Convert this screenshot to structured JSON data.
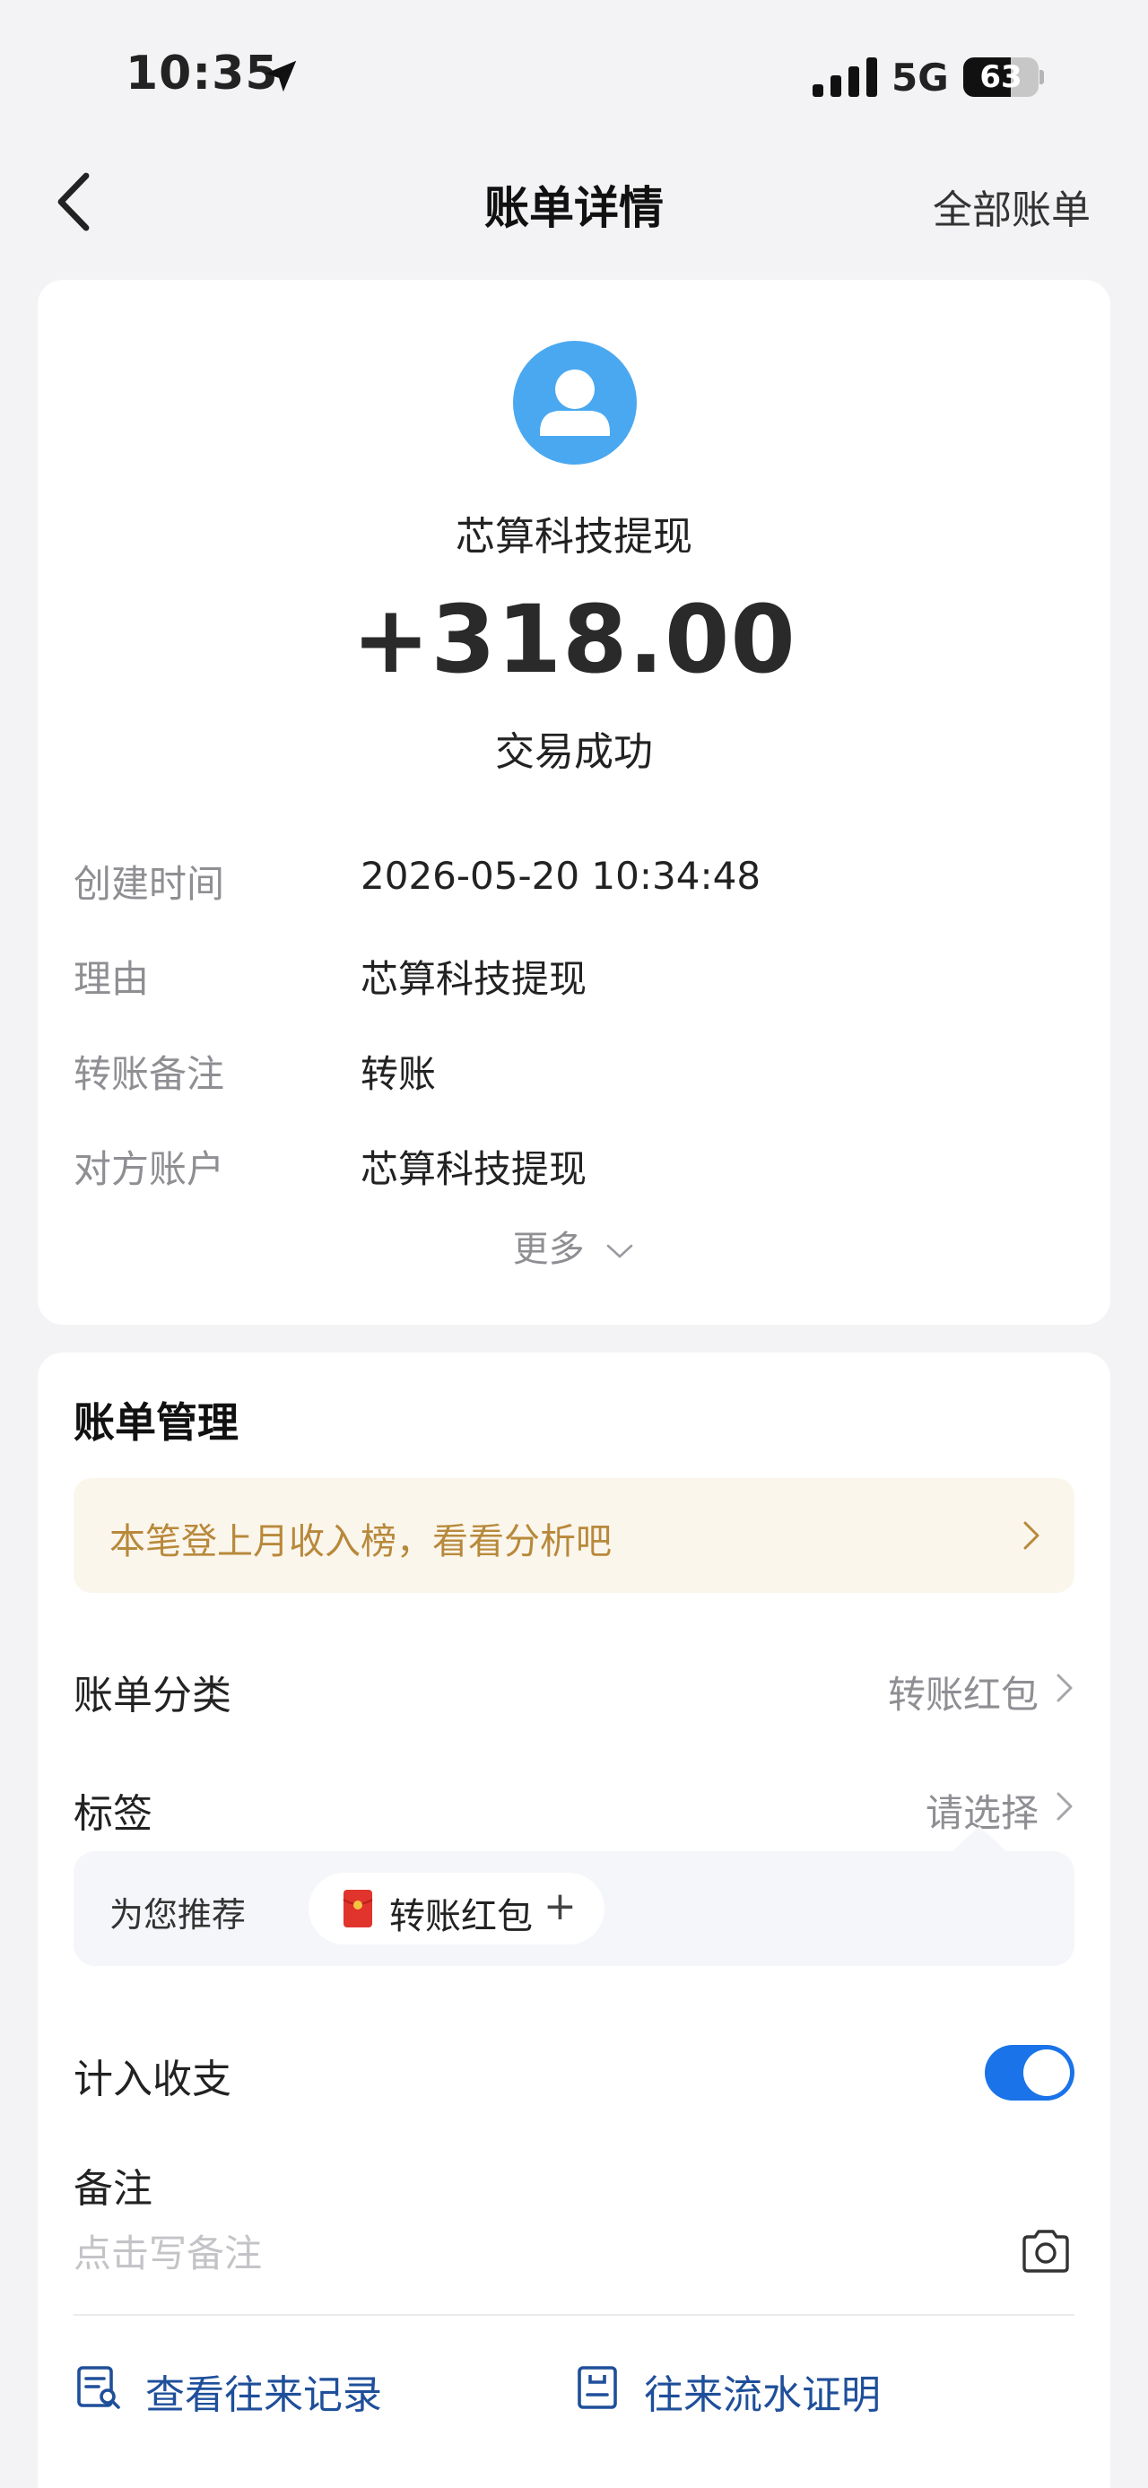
{
  "status_bar": {
    "time": "10:35",
    "network": "5G",
    "battery": "63",
    "battery_level_percent": 63
  },
  "header": {
    "title": "账单详情",
    "right_link": "全部账单"
  },
  "summary": {
    "payee": "芯算科技提现",
    "amount": "+318.00",
    "status": "交易成功"
  },
  "details": [
    {
      "label": "创建时间",
      "value": "2026-05-20 10:34:48"
    },
    {
      "label": "理由",
      "value": "芯算科技提现"
    },
    {
      "label": "转账备注",
      "value": "转账"
    },
    {
      "label": "对方账户",
      "value": "芯算科技提现"
    }
  ],
  "more_label": "更多",
  "manage": {
    "title": "账单管理",
    "banner_text": "本笔登上月收入榜，看看分析吧",
    "category": {
      "label": "账单分类",
      "value": "转账红包"
    },
    "tags": {
      "label": "标签",
      "value": "请选择"
    },
    "recommend": {
      "label": "为您推荐",
      "chip": "转账红包",
      "plus": "+"
    },
    "count_in": {
      "label": "计入收支",
      "enabled": true
    },
    "note": {
      "label": "备注",
      "placeholder": "点击写备注"
    },
    "links": {
      "history": "查看往来记录",
      "certificate": "往来流水证明"
    }
  },
  "colors": {
    "accent": "#1a73e8",
    "link": "#1f4f9a",
    "banner_text": "#b8893b",
    "avatar": "#4aa8f0"
  }
}
